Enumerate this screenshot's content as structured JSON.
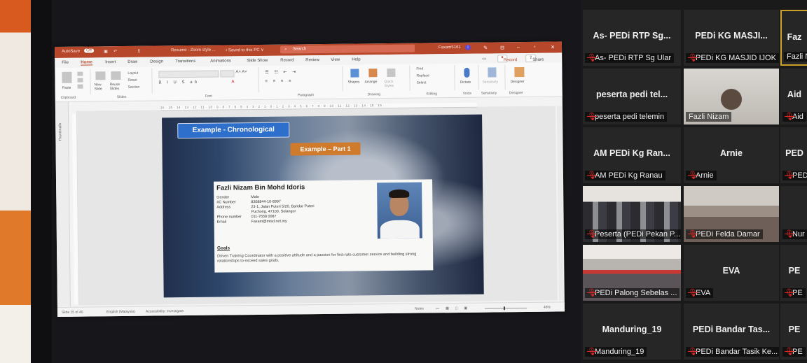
{
  "window": {
    "autosave": "AutoSave",
    "autosave_state": "Off",
    "doc_title": "Resume - Zoom style ...",
    "save_status": "• Saved to this PC ∨",
    "search_placeholder": "Search",
    "user": "Faxam5161"
  },
  "ribbon": {
    "tabs": [
      "File",
      "Home",
      "Insert",
      "Draw",
      "Design",
      "Transitions",
      "Animations",
      "Slide Show",
      "Record",
      "Review",
      "View",
      "Help"
    ],
    "record_button": "Record",
    "share_button": "Share",
    "group_labels": [
      "Clipboard",
      "Slides",
      "Font",
      "Paragraph",
      "Drawing",
      "Editing",
      "Voice",
      "Sensitivity",
      "Designer"
    ],
    "buttons": {
      "paste": "Paste",
      "new_slide": "New Slide",
      "reuse_slides": "Reuse Slides",
      "layout": "Layout",
      "reset": "Reset",
      "section": "Section",
      "shapes": "Shapes",
      "arrange": "Arrange",
      "quick_styles": "Quick Styles",
      "find": "Find",
      "replace": "Replace",
      "select": "Select",
      "dictate": "Dictate",
      "sensitivity": "Sensitivity",
      "designer": "Designer"
    }
  },
  "ruler_text": "16 · 15 · 14 · 13 · 12 · 11 · 10 · 9 · 8 · 7 · 6 · 5 · 4 · 3 · 2 · 1 · 0 · 1 · 2 · 3 · 4 · 5 · 6 · 7 · 8 · 9 · 10 · 11 · 12 · 13 · 14 · 15 · 16",
  "thumbnails_label": "Thumbnails",
  "slide": {
    "badge_blue": "Example - Chronological",
    "badge_orange": "Example – Part 1",
    "name": "Fazli Nizam Bin Mohd Idoris",
    "fields": [
      {
        "label": "Gender",
        "value": "Male"
      },
      {
        "label": "I/C Number",
        "value": "8308844-10-8997"
      },
      {
        "label": "Address",
        "value": "23-1, Jalan Puteri 5/20, Bandar Puteri"
      },
      {
        "label": "",
        "value": "Puchong, 47100, Selangor"
      },
      {
        "label": "Phone number",
        "value": "011-7658 0087"
      },
      {
        "label": "Email",
        "value": "Faxam@misd.net.my"
      }
    ],
    "goals_heading": "Goals",
    "goals_text": "Driven Training Coordinator with a positive attitude and a passion for first-rate customer service and building strong relationships to exceed sales goals."
  },
  "statusbar": {
    "slide_count": "Slide 15 of 40",
    "language": "English (Malaysia)",
    "accessibility": "Accessibility: Investigate",
    "notes": "Notes",
    "zoom_value": "48%"
  },
  "participants": [
    {
      "big": "As- PEDi RTP Sg...",
      "label": "As- PEDi RTP Sg Ular",
      "muted": true,
      "video": ""
    },
    {
      "big": "PEDi KG MASJI...",
      "label": "PEDi KG MASJID IJOK",
      "muted": true,
      "video": ""
    },
    {
      "big": "Faz",
      "label": "Fazli N",
      "muted": false,
      "video": "",
      "highlight": true
    },
    {
      "big": "peserta pedi tel...",
      "label": "peserta pedi telemin",
      "muted": true,
      "video": ""
    },
    {
      "big": "",
      "label": "Fazli Nizam",
      "muted": false,
      "video": "person"
    },
    {
      "big": "Aid",
      "label": "Aid",
      "muted": true,
      "video": ""
    },
    {
      "big": "AM PEDi Kg Ran...",
      "label": "AM PEDi Kg Ranau",
      "muted": true,
      "video": ""
    },
    {
      "big": "Arnie",
      "label": "Arnie",
      "muted": true,
      "video": ""
    },
    {
      "big": "PED",
      "label": "PED",
      "muted": true,
      "video": ""
    },
    {
      "big": "",
      "label": "Peserta (PEDi Pekan P...",
      "muted": true,
      "video": "office"
    },
    {
      "big": "",
      "label": "PEDi Felda Damar",
      "muted": true,
      "video": "room"
    },
    {
      "big": "",
      "label": "Nur",
      "muted": true,
      "video": ""
    },
    {
      "big": "",
      "label": "PEDi Palong Sebelas ...",
      "muted": true,
      "video": "red"
    },
    {
      "big": "EVA",
      "label": "EVA",
      "muted": true,
      "video": ""
    },
    {
      "big": "PE",
      "label": "PE",
      "muted": true,
      "video": ""
    },
    {
      "big": "Manduring_19",
      "label": "Manduring_19",
      "muted": true,
      "video": ""
    },
    {
      "big": "PEDi Bandar Tas...",
      "label": "PEDi Bandar Tasik Ke...",
      "muted": true,
      "video": ""
    },
    {
      "big": "PE",
      "label": "PE",
      "muted": true,
      "video": ""
    }
  ],
  "icons": {
    "muted_mic": "muted-mic-icon"
  }
}
